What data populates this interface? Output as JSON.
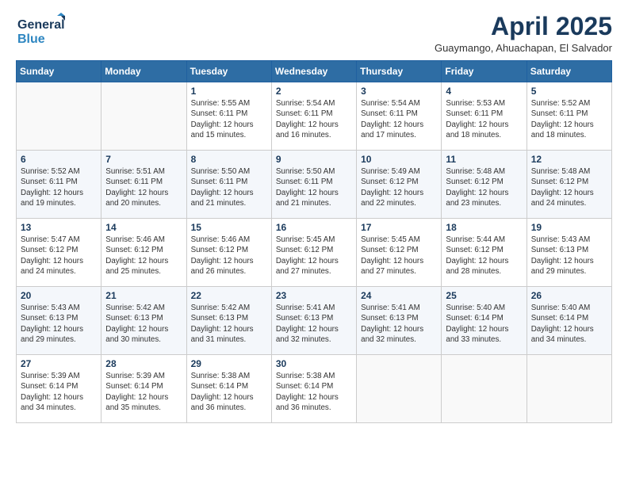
{
  "header": {
    "logo_line1": "General",
    "logo_line2": "Blue",
    "title": "April 2025",
    "subtitle": "Guaymango, Ahuachapan, El Salvador"
  },
  "weekdays": [
    "Sunday",
    "Monday",
    "Tuesday",
    "Wednesday",
    "Thursday",
    "Friday",
    "Saturday"
  ],
  "weeks": [
    [
      {
        "day": "",
        "info": ""
      },
      {
        "day": "",
        "info": ""
      },
      {
        "day": "1",
        "info": "Sunrise: 5:55 AM\nSunset: 6:11 PM\nDaylight: 12 hours\nand 15 minutes."
      },
      {
        "day": "2",
        "info": "Sunrise: 5:54 AM\nSunset: 6:11 PM\nDaylight: 12 hours\nand 16 minutes."
      },
      {
        "day": "3",
        "info": "Sunrise: 5:54 AM\nSunset: 6:11 PM\nDaylight: 12 hours\nand 17 minutes."
      },
      {
        "day": "4",
        "info": "Sunrise: 5:53 AM\nSunset: 6:11 PM\nDaylight: 12 hours\nand 18 minutes."
      },
      {
        "day": "5",
        "info": "Sunrise: 5:52 AM\nSunset: 6:11 PM\nDaylight: 12 hours\nand 18 minutes."
      }
    ],
    [
      {
        "day": "6",
        "info": "Sunrise: 5:52 AM\nSunset: 6:11 PM\nDaylight: 12 hours\nand 19 minutes."
      },
      {
        "day": "7",
        "info": "Sunrise: 5:51 AM\nSunset: 6:11 PM\nDaylight: 12 hours\nand 20 minutes."
      },
      {
        "day": "8",
        "info": "Sunrise: 5:50 AM\nSunset: 6:11 PM\nDaylight: 12 hours\nand 21 minutes."
      },
      {
        "day": "9",
        "info": "Sunrise: 5:50 AM\nSunset: 6:11 PM\nDaylight: 12 hours\nand 21 minutes."
      },
      {
        "day": "10",
        "info": "Sunrise: 5:49 AM\nSunset: 6:12 PM\nDaylight: 12 hours\nand 22 minutes."
      },
      {
        "day": "11",
        "info": "Sunrise: 5:48 AM\nSunset: 6:12 PM\nDaylight: 12 hours\nand 23 minutes."
      },
      {
        "day": "12",
        "info": "Sunrise: 5:48 AM\nSunset: 6:12 PM\nDaylight: 12 hours\nand 24 minutes."
      }
    ],
    [
      {
        "day": "13",
        "info": "Sunrise: 5:47 AM\nSunset: 6:12 PM\nDaylight: 12 hours\nand 24 minutes."
      },
      {
        "day": "14",
        "info": "Sunrise: 5:46 AM\nSunset: 6:12 PM\nDaylight: 12 hours\nand 25 minutes."
      },
      {
        "day": "15",
        "info": "Sunrise: 5:46 AM\nSunset: 6:12 PM\nDaylight: 12 hours\nand 26 minutes."
      },
      {
        "day": "16",
        "info": "Sunrise: 5:45 AM\nSunset: 6:12 PM\nDaylight: 12 hours\nand 27 minutes."
      },
      {
        "day": "17",
        "info": "Sunrise: 5:45 AM\nSunset: 6:12 PM\nDaylight: 12 hours\nand 27 minutes."
      },
      {
        "day": "18",
        "info": "Sunrise: 5:44 AM\nSunset: 6:12 PM\nDaylight: 12 hours\nand 28 minutes."
      },
      {
        "day": "19",
        "info": "Sunrise: 5:43 AM\nSunset: 6:13 PM\nDaylight: 12 hours\nand 29 minutes."
      }
    ],
    [
      {
        "day": "20",
        "info": "Sunrise: 5:43 AM\nSunset: 6:13 PM\nDaylight: 12 hours\nand 29 minutes."
      },
      {
        "day": "21",
        "info": "Sunrise: 5:42 AM\nSunset: 6:13 PM\nDaylight: 12 hours\nand 30 minutes."
      },
      {
        "day": "22",
        "info": "Sunrise: 5:42 AM\nSunset: 6:13 PM\nDaylight: 12 hours\nand 31 minutes."
      },
      {
        "day": "23",
        "info": "Sunrise: 5:41 AM\nSunset: 6:13 PM\nDaylight: 12 hours\nand 32 minutes."
      },
      {
        "day": "24",
        "info": "Sunrise: 5:41 AM\nSunset: 6:13 PM\nDaylight: 12 hours\nand 32 minutes."
      },
      {
        "day": "25",
        "info": "Sunrise: 5:40 AM\nSunset: 6:14 PM\nDaylight: 12 hours\nand 33 minutes."
      },
      {
        "day": "26",
        "info": "Sunrise: 5:40 AM\nSunset: 6:14 PM\nDaylight: 12 hours\nand 34 minutes."
      }
    ],
    [
      {
        "day": "27",
        "info": "Sunrise: 5:39 AM\nSunset: 6:14 PM\nDaylight: 12 hours\nand 34 minutes."
      },
      {
        "day": "28",
        "info": "Sunrise: 5:39 AM\nSunset: 6:14 PM\nDaylight: 12 hours\nand 35 minutes."
      },
      {
        "day": "29",
        "info": "Sunrise: 5:38 AM\nSunset: 6:14 PM\nDaylight: 12 hours\nand 36 minutes."
      },
      {
        "day": "30",
        "info": "Sunrise: 5:38 AM\nSunset: 6:14 PM\nDaylight: 12 hours\nand 36 minutes."
      },
      {
        "day": "",
        "info": ""
      },
      {
        "day": "",
        "info": ""
      },
      {
        "day": "",
        "info": ""
      }
    ]
  ]
}
